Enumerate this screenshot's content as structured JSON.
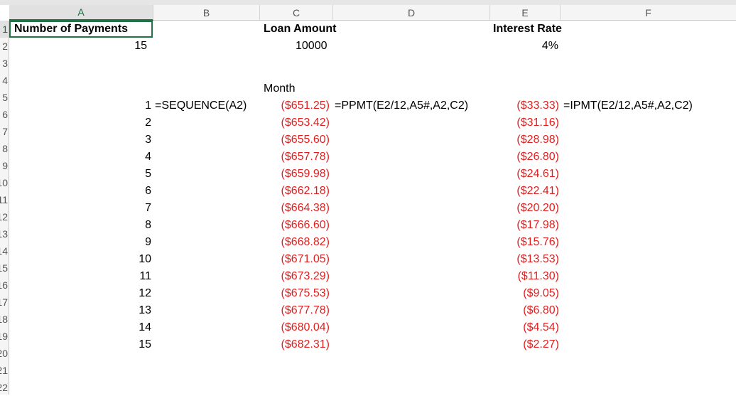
{
  "columns": [
    "A",
    "B",
    "C",
    "D",
    "E",
    "F"
  ],
  "rows": [
    "1",
    "2",
    "3",
    "4",
    "5",
    "6",
    "7",
    "8",
    "9",
    "10",
    "11",
    "12",
    "13",
    "14",
    "15",
    "16",
    "17",
    "18",
    "19",
    "20",
    "21",
    "22"
  ],
  "headers": {
    "number_of_payments": "Number of Payments",
    "loan_amount": "Loan Amount",
    "interest_rate": "Interest Rate"
  },
  "values": {
    "payments": "15",
    "loan": "10000",
    "rate": "4%"
  },
  "month_label": "Month",
  "formulas": {
    "sequence": "=SEQUENCE(A2)",
    "ppmt": "=PPMT(E2/12,A5#,A2,C2)",
    "ipmt": "=IPMT(E2/12,A5#,A2,C2)"
  },
  "months": [
    "1",
    "2",
    "3",
    "4",
    "5",
    "6",
    "7",
    "8",
    "9",
    "10",
    "11",
    "12",
    "13",
    "14",
    "15"
  ],
  "principal": [
    "($651.25)",
    "($653.42)",
    "($655.60)",
    "($657.78)",
    "($659.98)",
    "($662.18)",
    "($664.38)",
    "($666.60)",
    "($668.82)",
    "($671.05)",
    "($673.29)",
    "($675.53)",
    "($677.78)",
    "($680.04)",
    "($682.31)"
  ],
  "interest": [
    "($33.33)",
    "($31.16)",
    "($28.98)",
    "($26.80)",
    "($24.61)",
    "($22.41)",
    "($20.20)",
    "($17.98)",
    "($15.76)",
    "($13.53)",
    "($11.30)",
    "($9.05)",
    "($6.80)",
    "($4.54)",
    "($2.27)"
  ]
}
